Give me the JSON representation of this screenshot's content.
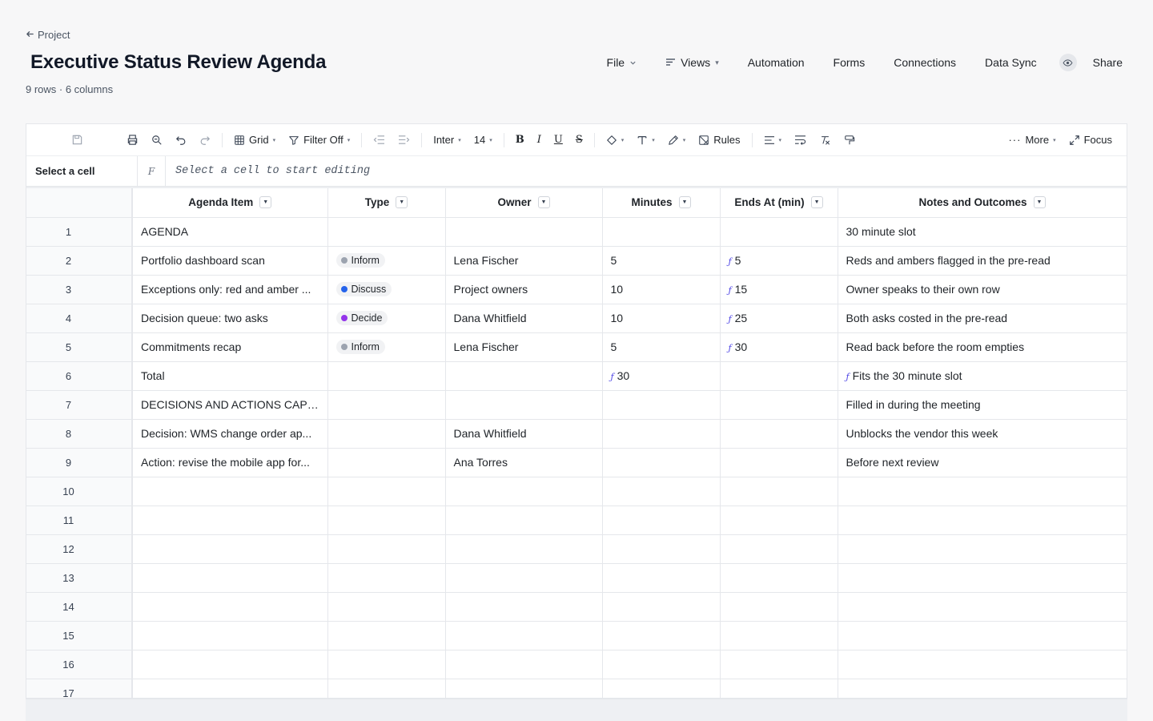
{
  "back_link": "Project",
  "title": "Executive Status Review Agenda",
  "meta": "9 rows · 6 columns",
  "nav": {
    "file": "File",
    "views": "Views",
    "automation": "Automation",
    "forms": "Forms",
    "connections": "Connections",
    "data_sync": "Data Sync",
    "share": "Share"
  },
  "toolbar": {
    "view": "Grid",
    "filter": "Filter Off",
    "font": "Inter",
    "size": "14",
    "rules": "Rules",
    "more": "More",
    "focus": "Focus"
  },
  "formula_bar": {
    "cell_ref": "Select a cell",
    "fx": "F",
    "placeholder": "Select a cell to start editing"
  },
  "columns": [
    "Agenda Item",
    "Type",
    "Owner",
    "Minutes",
    "Ends At (min)",
    "Notes and Outcomes"
  ],
  "type_colors": {
    "Inform": "#9ca3af",
    "Discuss": "#2563eb",
    "Decide": "#9333ea"
  },
  "rows": [
    {
      "num": "1",
      "item": "AGENDA",
      "type": "",
      "owner": "",
      "minutes": "",
      "minutes_fx": false,
      "ends": "",
      "ends_fx": false,
      "notes": "30 minute slot",
      "notes_fx": false
    },
    {
      "num": "2",
      "item": "Portfolio dashboard scan",
      "type": "Inform",
      "owner": "Lena Fischer",
      "minutes": "5",
      "minutes_fx": false,
      "ends": "5",
      "ends_fx": true,
      "notes": "Reds and ambers flagged in the pre-read",
      "notes_fx": false
    },
    {
      "num": "3",
      "item": "Exceptions only: red and amber ...",
      "type": "Discuss",
      "owner": "Project owners",
      "minutes": "10",
      "minutes_fx": false,
      "ends": "15",
      "ends_fx": true,
      "notes": "Owner speaks to their own row",
      "notes_fx": false
    },
    {
      "num": "4",
      "item": "Decision queue: two asks",
      "type": "Decide",
      "owner": "Dana Whitfield",
      "minutes": "10",
      "minutes_fx": false,
      "ends": "25",
      "ends_fx": true,
      "notes": "Both asks costed in the pre-read",
      "notes_fx": false
    },
    {
      "num": "5",
      "item": "Commitments recap",
      "type": "Inform",
      "owner": "Lena Fischer",
      "minutes": "5",
      "minutes_fx": false,
      "ends": "30",
      "ends_fx": true,
      "notes": "Read back before the room empties",
      "notes_fx": false
    },
    {
      "num": "6",
      "item": "Total",
      "type": "",
      "owner": "",
      "minutes": "30",
      "minutes_fx": true,
      "ends": "",
      "ends_fx": false,
      "notes": "Fits the 30 minute slot",
      "notes_fx": true
    },
    {
      "num": "7",
      "item": "DECISIONS AND ACTIONS CAPT...",
      "type": "",
      "owner": "",
      "minutes": "",
      "minutes_fx": false,
      "ends": "",
      "ends_fx": false,
      "notes": "Filled in during the meeting",
      "notes_fx": false
    },
    {
      "num": "8",
      "item": "Decision: WMS change order ap...",
      "type": "",
      "owner": "Dana Whitfield",
      "minutes": "",
      "minutes_fx": false,
      "ends": "",
      "ends_fx": false,
      "notes": "Unblocks the vendor this week",
      "notes_fx": false
    },
    {
      "num": "9",
      "item": "Action: revise the mobile app for...",
      "type": "",
      "owner": "Ana Torres",
      "minutes": "",
      "minutes_fx": false,
      "ends": "",
      "ends_fx": false,
      "notes": "Before next review",
      "notes_fx": false
    }
  ],
  "empty_rows": [
    "10",
    "11",
    "12",
    "13",
    "14",
    "15",
    "16",
    "17"
  ]
}
